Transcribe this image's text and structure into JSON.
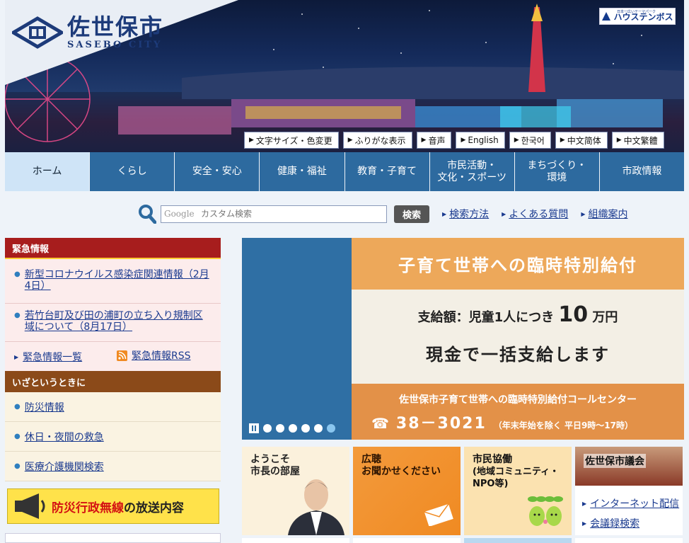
{
  "header": {
    "logo_jp": "佐世保市",
    "logo_en": "SASEBO CITY",
    "sponsor_sub": "日本一広いテーマパーク",
    "sponsor": "ハウステンボス"
  },
  "utility": [
    "文字サイズ・色変更",
    "ふりがな表示",
    "音声",
    "English",
    "한국어",
    "中文简体",
    "中文繁體"
  ],
  "nav": [
    {
      "label": "ホーム",
      "active": true
    },
    {
      "label": "くらし"
    },
    {
      "label": "安全・安心"
    },
    {
      "label": "健康・福祉"
    },
    {
      "label": "教育・子育て"
    },
    {
      "label": "市民活動・\n文化・スポーツ"
    },
    {
      "label": "まちづくり・\n環境"
    },
    {
      "label": "市政情報"
    }
  ],
  "search": {
    "placeholder": "カスタム検索",
    "google": "Google",
    "button": "検索",
    "links": [
      "検索方法",
      "よくある質問",
      "組織案内"
    ]
  },
  "emergency": {
    "title": "緊急情報",
    "items": [
      "新型コロナウイルス感染症関連情報（2月4日）",
      "若竹台町及び田の浦町の立ち入り規制区域について（8月17日）"
    ],
    "list_link": "緊急情報一覧",
    "rss_link": "緊急情報RSS"
  },
  "ready": {
    "title": "いざというときに",
    "items": [
      "防災情報",
      "休日・夜間の救急",
      "医療介護機関検索"
    ]
  },
  "bousai_banner": {
    "red": "防災行政無線",
    "black": "の放送内容"
  },
  "carousel": {
    "headline": "子育て世帯への臨時特別給付",
    "amount_prefix": "支給額：児童1人につき",
    "amount_value": "10",
    "amount_unit": "万円",
    "cash": "現金で一括支給します",
    "center": "佐世保市子育て世帯への臨時特別給付コールセンター",
    "tel": "38－3021",
    "tel_note": "（年末年始を除く 平日9時～17時）",
    "slide_count": 6,
    "active_slide": 6
  },
  "tiles": {
    "mayor_line1": "ようこそ",
    "mayor_line2": "市長の部屋",
    "hearing_line1": "広聴",
    "hearing_line2": "お聞かせください",
    "kyodo_line1": "市民協働",
    "kyodo_line2": "(地域コミュニティ・",
    "kyodo_line3": "NPO等)",
    "council_title": "佐世保市議会",
    "council_links": [
      "インターネット配信",
      "会議録検索"
    ]
  },
  "colors": {
    "nav_bg": "#2d6a9f",
    "nav_active": "#cfe4f7",
    "emergency": "#a71d1d",
    "ready": "#8b4a19",
    "carousel_orange": "#eda85a"
  }
}
